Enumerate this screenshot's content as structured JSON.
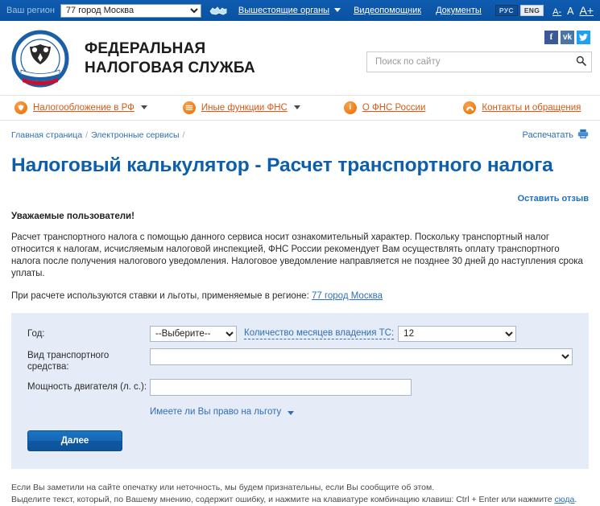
{
  "topbar": {
    "region_label": "Ваш регион",
    "region_value": "77 город Москва",
    "map_icon": "map-icon",
    "links": [
      {
        "label": "Вышестоящие органы",
        "has_caret": true
      },
      {
        "label": "Видеопомощник",
        "has_caret": false
      },
      {
        "label": "Документы",
        "has_caret": false
      }
    ],
    "lang_ru": "РУС",
    "lang_en": "ENG",
    "font_decrease": "A-",
    "font_normal": "A",
    "font_increase": "A+"
  },
  "header": {
    "brand_line1": "ФЕДЕРАЛЬНАЯ",
    "brand_line2": "НАЛОГОВАЯ СЛУЖБА",
    "logo_name": "fns-emblem-logo",
    "social": [
      {
        "name": "facebook-icon",
        "glyph": "f"
      },
      {
        "name": "vk-icon",
        "glyph": "vk"
      },
      {
        "name": "twitter-icon",
        "glyph": "t"
      }
    ],
    "search_placeholder": "Поиск по сайту",
    "search_value": "",
    "search_icon": "search-icon"
  },
  "mainnav": [
    {
      "label": "Налогообложение в РФ",
      "icon": "eagle-emblem-icon",
      "glyph": "⚘",
      "caret": true
    },
    {
      "label": "Иные функции ФНС",
      "icon": "menu-lines-icon",
      "glyph": "☰",
      "caret": true
    },
    {
      "label": "О ФНС России",
      "icon": "info-icon",
      "glyph": "i",
      "caret": false
    },
    {
      "label": "Контакты и обращения",
      "icon": "phone-icon",
      "glyph": "☎",
      "caret": false
    }
  ],
  "breadcrumb": {
    "items": [
      "Главная страница",
      "Электронные сервисы"
    ],
    "separator": "/"
  },
  "print": {
    "label": "Распечатать",
    "icon": "printer-icon"
  },
  "page_title": "Налоговый калькулятор - Расчет транспортного налога",
  "feedback_link": "Оставить отзыв",
  "notice": {
    "title": "Уважаемые пользователи!",
    "body": "Расчет транспортного налога с помощью данного сервиса носит ознакомительный характер. Поскольку транспортный налог относится к налогам, исчисляемым налоговой инспекцией, ФНС России рекомендует Вам осуществлять оплату транспортного налога после получения налогового уведомления. Налоговое уведомление направляется не позднее 30 дней до наступления срока уплаты.",
    "region_prefix": "При расчете используются ставки и льготы, применяемые в регионе: ",
    "region_link": "77 город Москва"
  },
  "form": {
    "year_label": "Год:",
    "year_value": "--Выберите--",
    "year_options": [
      "--Выберите--"
    ],
    "months_label": "Количество месяцев владения ТС:",
    "months_value": "12",
    "months_options": [
      "12"
    ],
    "vehicle_label": "Вид транспортного средства:",
    "vehicle_value": "",
    "vehicle_options": [
      ""
    ],
    "power_label": "Мощность двигателя (л. с.):",
    "power_value": "",
    "power_placeholder": "",
    "benefit_link": "Имеете ли Вы право на льготу",
    "submit_label": "Далее"
  },
  "footer": {
    "line1": "Если Вы заметили на сайте опечатку или неточность, мы будем признательны, если Вы сообщите об этом.",
    "line2_prefix": "Выделите текст, который, по Вашему мнению, содержит ошибку, и нажмите на клавиатуре комбинацию клавиш: Ctrl + Enter или нажмите ",
    "line2_link": "сюда",
    "line2_suffix": "."
  },
  "colors": {
    "topbar_blue": "#0a51a0",
    "brand_orange": "#d65a12",
    "title_blue": "#0d5fae",
    "panel_bg": "#e6ecf7",
    "link_blue": "#2f6fb5"
  }
}
